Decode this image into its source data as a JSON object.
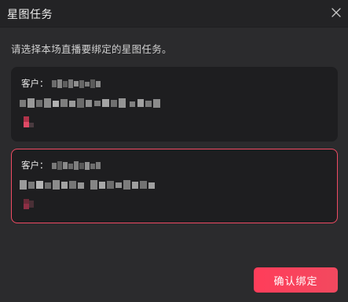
{
  "dialog": {
    "title": "星图任务",
    "instruction": "请选择本场直播要绑定的星图任务。"
  },
  "tasks": [
    {
      "client_label": "客户：",
      "selected": false
    },
    {
      "client_label": "客户：",
      "selected": true
    }
  ],
  "footer": {
    "confirm_label": "确认绑定"
  },
  "colors": {
    "accent": "#ff3d5a",
    "selected_border": "#ef4b63",
    "card_bg": "#1e1e20",
    "dialog_bg": "#2b2b2d"
  },
  "icons": {
    "close": "close-icon"
  }
}
